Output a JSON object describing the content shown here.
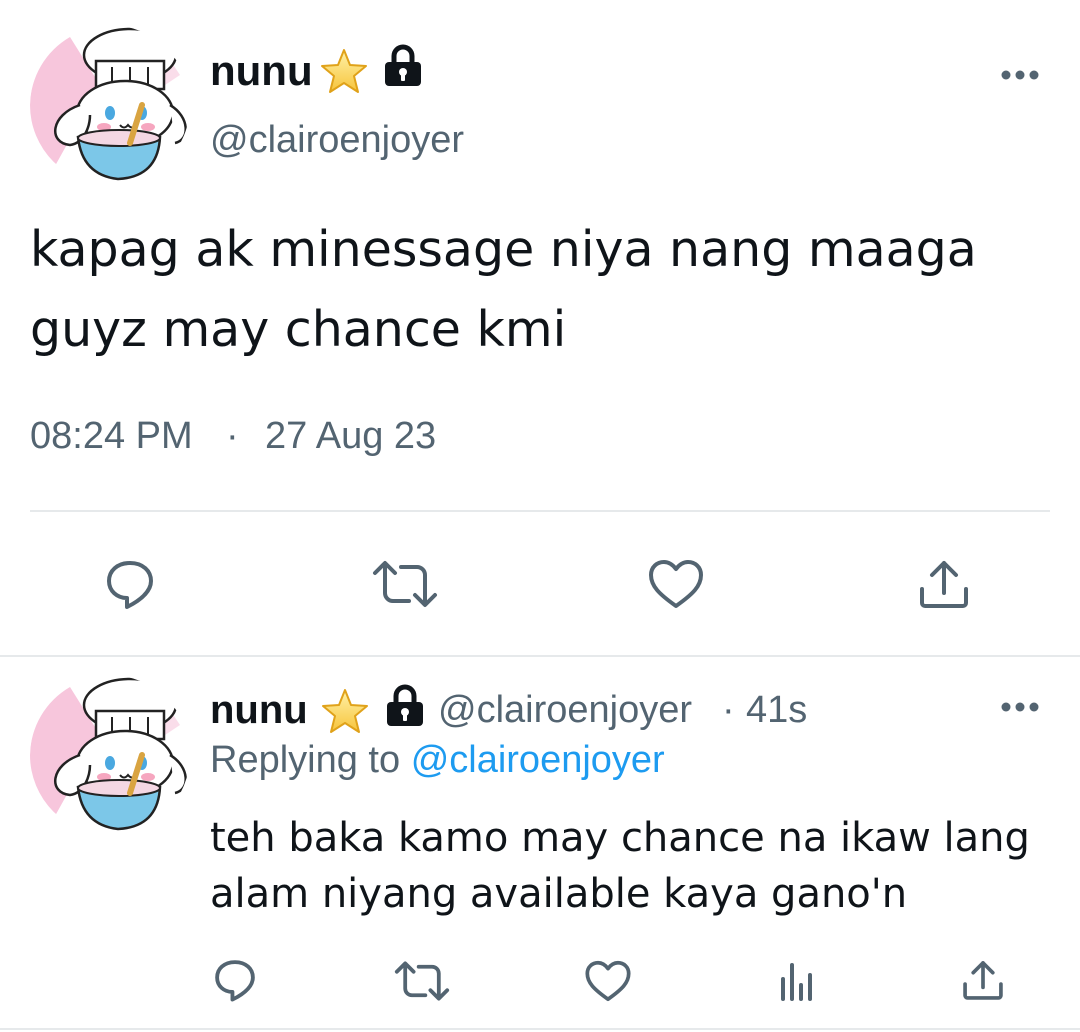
{
  "main_tweet": {
    "display_name": "nunu",
    "handle": "@clairoenjoyer",
    "text_line1": "kapag ak minessage niya nang maaga",
    "text_line2": "guyz may chance kmi",
    "time": "08:24 PM",
    "separator": "·",
    "date": "27 Aug 23",
    "icons": [
      "star-icon",
      "lock-icon",
      "more-icon",
      "reply-icon",
      "retweet-icon",
      "like-icon",
      "share-icon"
    ]
  },
  "reply_tweet": {
    "display_name": "nunu",
    "handle": "@clairoenjoyer",
    "dot": "·",
    "age": "41s",
    "replying_prefix": "Replying to",
    "replying_handle": "@clairoenjoyer",
    "text_line1": "teh baka kamo may chance na ikaw lang",
    "text_line2": "alam niyang available kaya gano'n",
    "icons": [
      "star-icon",
      "lock-icon",
      "more-icon",
      "reply-icon",
      "retweet-icon",
      "like-icon",
      "analytics-icon",
      "share-icon"
    ]
  },
  "colors": {
    "text": "#0f1419",
    "secondary": "#536471",
    "link": "#1d9bf0",
    "divider": "#e6e9eb",
    "avatar_pink": "#f7c6dc"
  }
}
